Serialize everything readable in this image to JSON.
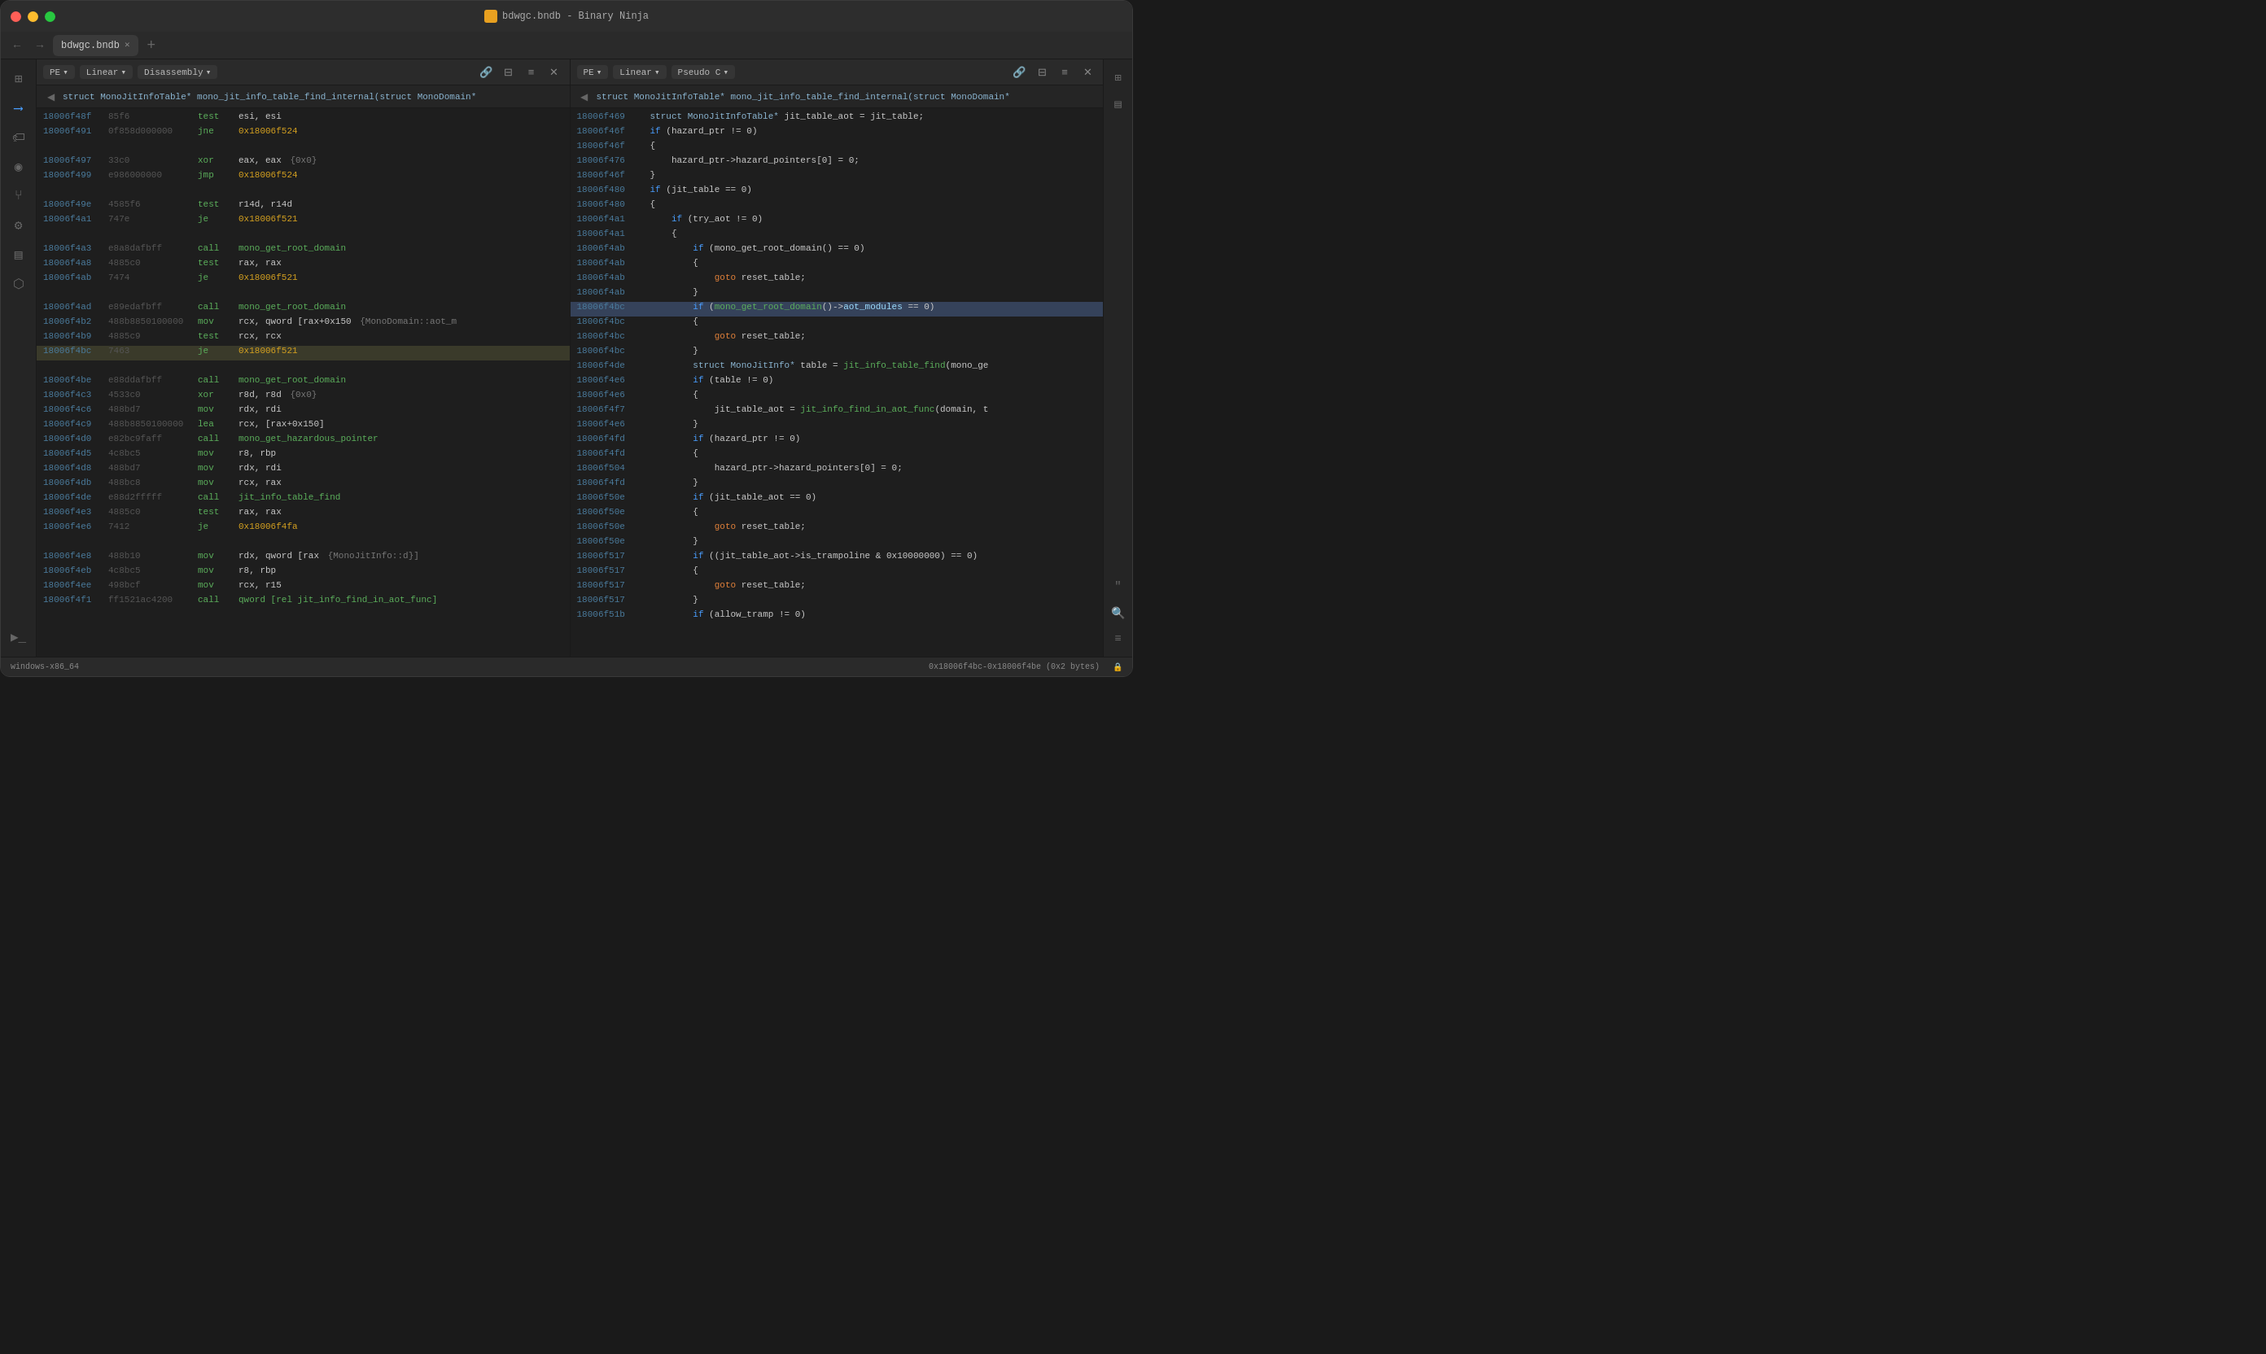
{
  "window": {
    "title": "bdwgc.bndb - Binary Ninja",
    "tab_name": "bdwgc.bndb"
  },
  "left_pane": {
    "toolbar": {
      "pe_label": "PE",
      "linear_label": "Linear",
      "disasm_label": "Disassembly"
    },
    "func_sig": "struct MonoJitInfoTable* mono_jit_info_table_find_internal(struct MonoDomain*",
    "disasm_lines": [
      {
        "addr": "18006f48f",
        "bytes": "85f6",
        "mnem": "test",
        "ops": "esi, esi",
        "comment": ""
      },
      {
        "addr": "18006f491",
        "bytes": "0f858d000000",
        "mnem": "jne",
        "ops": "0x18006f524",
        "comment": ""
      },
      {
        "addr": "",
        "bytes": "",
        "mnem": "",
        "ops": "",
        "comment": ""
      },
      {
        "addr": "18006f497",
        "bytes": "33c0",
        "mnem": "xor",
        "ops": "eax, eax",
        "comment": "{0x0}"
      },
      {
        "addr": "18006f499",
        "bytes": "e986000000",
        "mnem": "jmp",
        "ops": "0x18006f524",
        "comment": ""
      },
      {
        "addr": "",
        "bytes": "",
        "mnem": "",
        "ops": "",
        "comment": ""
      },
      {
        "addr": "18006f49e",
        "bytes": "4585f6",
        "mnem": "test",
        "ops": "r14d, r14d",
        "comment": ""
      },
      {
        "addr": "18006f4a1",
        "bytes": "747e",
        "mnem": "je",
        "ops": "0x18006f521",
        "comment": ""
      },
      {
        "addr": "",
        "bytes": "",
        "mnem": "",
        "ops": "",
        "comment": ""
      },
      {
        "addr": "18006f4a3",
        "bytes": "e8a8dafbff",
        "mnem": "call",
        "ops": "mono_get_root_domain",
        "comment": ""
      },
      {
        "addr": "18006f4a8",
        "bytes": "4885c0",
        "mnem": "test",
        "ops": "rax, rax",
        "comment": ""
      },
      {
        "addr": "18006f4ab",
        "bytes": "7474",
        "mnem": "je",
        "ops": "0x18006f521",
        "comment": ""
      },
      {
        "addr": "",
        "bytes": "",
        "mnem": "",
        "ops": "",
        "comment": ""
      },
      {
        "addr": "18006f4ad",
        "bytes": "e89edafbff",
        "mnem": "call",
        "ops": "mono_get_root_domain",
        "comment": ""
      },
      {
        "addr": "18006f4b2",
        "bytes": "488b8850100000",
        "mnem": "mov",
        "ops": "rcx, qword [rax+0x150",
        "comment": "{MonoDomain::aot_m"
      },
      {
        "addr": "18006f4b9",
        "bytes": "4885c9",
        "mnem": "test",
        "ops": "rcx, rcx",
        "comment": ""
      },
      {
        "addr": "18006f4bc",
        "bytes": "7463",
        "mnem": "je",
        "ops": "0x18006f521",
        "comment": "",
        "highlight": true
      },
      {
        "addr": "",
        "bytes": "",
        "mnem": "",
        "ops": "",
        "comment": ""
      },
      {
        "addr": "18006f4be",
        "bytes": "e88ddafbff",
        "mnem": "call",
        "ops": "mono_get_root_domain",
        "comment": ""
      },
      {
        "addr": "18006f4c3",
        "bytes": "4533c0",
        "mnem": "xor",
        "ops": "r8d, r8d",
        "comment": "{0x0}"
      },
      {
        "addr": "18006f4c6",
        "bytes": "488bd7",
        "mnem": "mov",
        "ops": "rdx, rdi",
        "comment": ""
      },
      {
        "addr": "18006f4c9",
        "bytes": "488b8850100000",
        "mnem": "lea",
        "ops": "rcx, [rax+0x150]",
        "comment": ""
      },
      {
        "addr": "18006f4d0",
        "bytes": "e82bc9faff",
        "mnem": "call",
        "ops": "mono_get_hazardous_pointer",
        "comment": ""
      },
      {
        "addr": "18006f4d5",
        "bytes": "4c8bc5",
        "mnem": "mov",
        "ops": "r8, rbp",
        "comment": ""
      },
      {
        "addr": "18006f4d8",
        "bytes": "488bd7",
        "mnem": "mov",
        "ops": "rdx, rdi",
        "comment": ""
      },
      {
        "addr": "18006f4db",
        "bytes": "488bc8",
        "mnem": "mov",
        "ops": "rcx, rax",
        "comment": ""
      },
      {
        "addr": "18006f4de",
        "bytes": "e88d2fffff",
        "mnem": "call",
        "ops": "jit_info_table_find",
        "comment": ""
      },
      {
        "addr": "18006f4e3",
        "bytes": "4885c0",
        "mnem": "test",
        "ops": "rax, rax",
        "comment": ""
      },
      {
        "addr": "18006f4e6",
        "bytes": "7412",
        "mnem": "je",
        "ops": "0x18006f4fa",
        "comment": ""
      },
      {
        "addr": "",
        "bytes": "",
        "mnem": "",
        "ops": "",
        "comment": ""
      },
      {
        "addr": "18006f4e8",
        "bytes": "488b10",
        "mnem": "mov",
        "ops": "rdx, qword [rax",
        "comment": "{MonoJitInfo::d}]"
      },
      {
        "addr": "18006f4eb",
        "bytes": "4c8bc5",
        "mnem": "mov",
        "ops": "r8, rbp",
        "comment": ""
      },
      {
        "addr": "18006f4ee",
        "bytes": "498bcf",
        "mnem": "mov",
        "ops": "rcx, r15",
        "comment": ""
      },
      {
        "addr": "18006f4f1",
        "bytes": "ff1521ac4200",
        "mnem": "call",
        "ops": "qword [rel jit_info_find_in_aot_func]",
        "comment": ""
      }
    ]
  },
  "right_pane": {
    "toolbar": {
      "pe_label": "PE",
      "linear_label": "Linear",
      "pseudoc_label": "Pseudo C"
    },
    "func_sig": "struct MonoJitInfoTable* mono_jit_info_table_find_internal(struct MonoDomain*",
    "pc_lines": [
      {
        "addr": "18006f469",
        "code": "struct MonoJitInfoTable* jit_table_aot = jit_table;"
      },
      {
        "addr": "18006f46f",
        "code": "if (hazard_ptr != 0)"
      },
      {
        "addr": "18006f46f",
        "code": "{"
      },
      {
        "addr": "18006f476",
        "code": "    hazard_ptr->hazard_pointers[0] = 0;"
      },
      {
        "addr": "18006f46f",
        "code": "}"
      },
      {
        "addr": "18006f480",
        "code": "if (jit_table == 0)"
      },
      {
        "addr": "18006f480",
        "code": "{"
      },
      {
        "addr": "18006f4a1",
        "code": "    if (try_aot != 0)"
      },
      {
        "addr": "18006f4a1",
        "code": "    {"
      },
      {
        "addr": "18006f4ab",
        "code": "        if (mono_get_root_domain() == 0)"
      },
      {
        "addr": "18006f4ab",
        "code": "        {"
      },
      {
        "addr": "18006f4ab",
        "code": "            goto reset_table;"
      },
      {
        "addr": "18006f4ab",
        "code": "        }"
      },
      {
        "addr": "18006f4bc",
        "code": "        if (mono_get_root_domain()->aot_modules == 0)",
        "highlight": true
      },
      {
        "addr": "18006f4bc",
        "code": "        {"
      },
      {
        "addr": "18006f4bc",
        "code": "            goto reset_table;"
      },
      {
        "addr": "18006f4bc",
        "code": "        }"
      },
      {
        "addr": "18006f4de",
        "code": "        struct MonoJitInfo* table = jit_info_table_find(mono_ge"
      },
      {
        "addr": "18006f4e6",
        "code": "        if (table != 0)"
      },
      {
        "addr": "18006f4e6",
        "code": "        {"
      },
      {
        "addr": "18006f4f7",
        "code": "            jit_table_aot = jit_info_find_in_aot_func(domain, t"
      },
      {
        "addr": "18006f4e6",
        "code": "        }"
      },
      {
        "addr": "18006f4fd",
        "code": "        if (hazard_ptr != 0)"
      },
      {
        "addr": "18006f4fd",
        "code": "        {"
      },
      {
        "addr": "18006f504",
        "code": "            hazard_ptr->hazard_pointers[0] = 0;"
      },
      {
        "addr": "18006f4fd",
        "code": "        }"
      },
      {
        "addr": "18006f50e",
        "code": "        if (jit_table_aot == 0)"
      },
      {
        "addr": "18006f50e",
        "code": "        {"
      },
      {
        "addr": "18006f50e",
        "code": "            goto reset_table;"
      },
      {
        "addr": "18006f50e",
        "code": "        }"
      },
      {
        "addr": "18006f517",
        "code": "        if ((jit_table_aot->is_trampoline & 0x10000000) == 0)"
      },
      {
        "addr": "18006f517",
        "code": "        {"
      },
      {
        "addr": "18006f517",
        "code": "            goto reset_table;"
      },
      {
        "addr": "18006f517",
        "code": "        }"
      },
      {
        "addr": "18006f51b",
        "code": "        if (allow_tramp != 0)"
      }
    ]
  },
  "status_bar": {
    "arch": "windows-x86_64",
    "address_range": "0x18006f4bc-0x18006f4be (0x2 bytes)"
  }
}
